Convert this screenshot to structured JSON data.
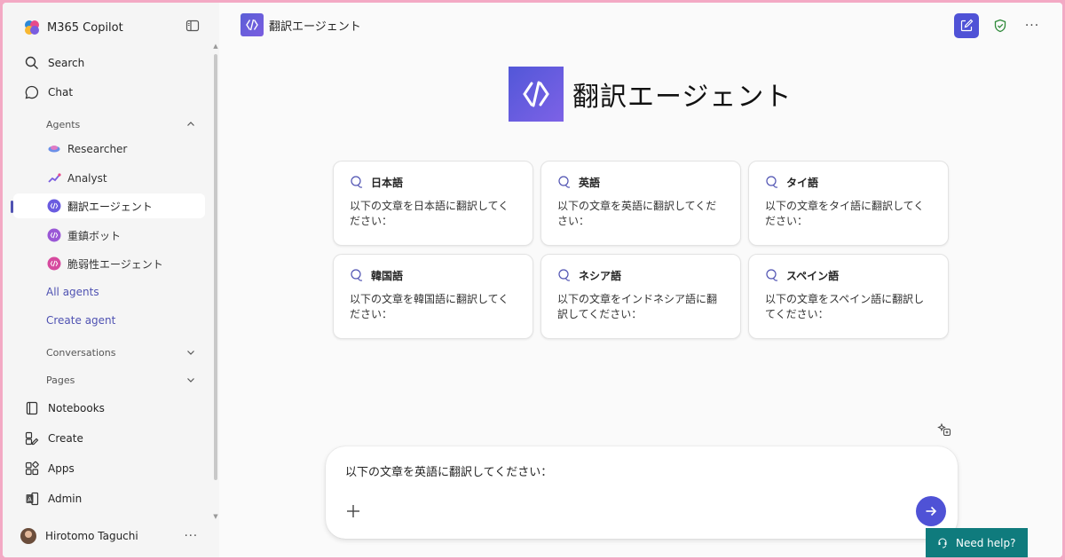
{
  "sidebar": {
    "app_title": "M365 Copilot",
    "nav_top": [
      {
        "label": "Search",
        "icon": "search-icon"
      },
      {
        "label": "Chat",
        "icon": "chat-icon"
      }
    ],
    "agents_heading": "Agents",
    "agents": [
      {
        "label": "Researcher",
        "icon": "researcher-icon",
        "active": false
      },
      {
        "label": "Analyst",
        "icon": "analyst-icon",
        "active": false
      },
      {
        "label": "翻訳エージェント",
        "icon": "translation-agent-icon",
        "active": true
      },
      {
        "label": "重鎮ボット",
        "icon": "bot-icon",
        "active": false
      },
      {
        "label": "脆弱性エージェント",
        "icon": "vulnerability-agent-icon",
        "active": false
      }
    ],
    "all_agents": "All agents",
    "create_agent": "Create agent",
    "conversations_heading": "Conversations",
    "pages_heading": "Pages",
    "nav_bottom": [
      {
        "label": "Notebooks",
        "icon": "notebook-icon"
      },
      {
        "label": "Create",
        "icon": "create-icon"
      },
      {
        "label": "Apps",
        "icon": "apps-icon"
      },
      {
        "label": "Admin",
        "icon": "admin-icon"
      }
    ],
    "user_name": "Hirotomo Taguchi",
    "user_more": "···"
  },
  "topbar": {
    "agent_title": "翻訳エージェント",
    "more": "···"
  },
  "hero": {
    "title": "翻訳エージェント"
  },
  "prompts": [
    {
      "title": "日本語",
      "text": "以下の文章を日本語に翻訳してください："
    },
    {
      "title": "英語",
      "text": "以下の文章を英語に翻訳してください："
    },
    {
      "title": "タイ語",
      "text": "以下の文章をタイ語に翻訳してください："
    },
    {
      "title": "韓国語",
      "text": "以下の文章を韓国語に翻訳してください："
    },
    {
      "title": "ネシア語",
      "text": "以下の文章をインドネシア語に翻訳してください："
    },
    {
      "title": "スペイン語",
      "text": "以下の文章をスペイン語に翻訳してください："
    }
  ],
  "composer": {
    "value": "以下の文章を英語に翻訳してください："
  },
  "help": {
    "label": "Need help?"
  },
  "colors": {
    "accent": "#4f52d6",
    "help_bg": "#0f7b7d",
    "window_border": "#f3a9c4"
  }
}
